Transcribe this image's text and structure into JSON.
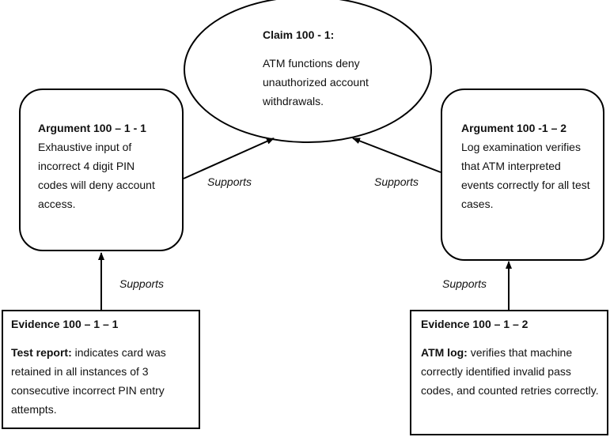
{
  "diagram": {
    "claim": {
      "title": "Claim 100 - 1:",
      "text": "ATM functions deny unauthorized account withdrawals."
    },
    "arguments": [
      {
        "title": "Argument 100 – 1 - 1",
        "text": "Exhaustive input of incorrect 4 digit PIN codes will deny account access."
      },
      {
        "title": "Argument 100 -1 – 2",
        "text": "Log examination verifies that ATM interpreted events correctly for all test cases."
      }
    ],
    "evidence": [
      {
        "title": "Evidence 100 – 1 – 1",
        "lead": "Test report:",
        "text": " indicates card was retained in all instances of 3 consecutive incorrect PIN entry attempts."
      },
      {
        "title": "Evidence 100 – 1 – 2",
        "lead": "ATM log:",
        "text": " verifies that machine correctly identified invalid pass codes, and counted retries correctly."
      }
    ],
    "edge_labels": {
      "arg1_to_claim": "Supports",
      "arg2_to_claim": "Supports",
      "ev1_to_arg1": "Supports",
      "ev2_to_arg2": "Supports"
    }
  }
}
